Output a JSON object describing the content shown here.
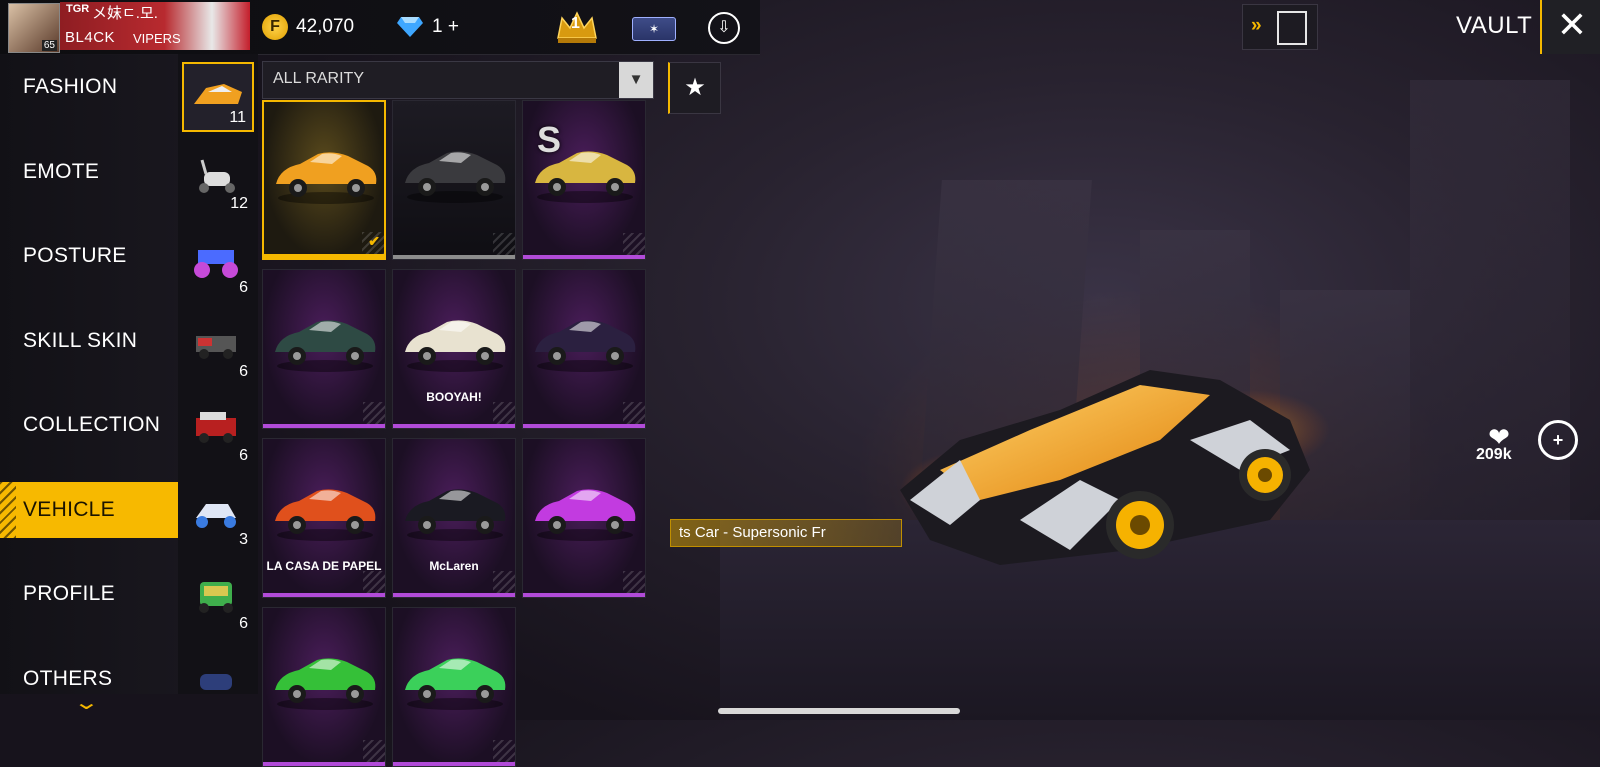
{
  "player": {
    "level": "65",
    "clan_tag": "TGR",
    "clan_name": "メ妺ㄷ.모.",
    "name": "BL4CK",
    "name_suffix": "VIPERS"
  },
  "currency": {
    "gold_symbol": "F",
    "gold": "42,070",
    "diamonds": "1",
    "diamonds_add": "+"
  },
  "top_icons": {
    "rank": "1",
    "card_label": "✶",
    "cloud": "⇩"
  },
  "header": {
    "forward": "»",
    "title": "VAULT",
    "close": "✕"
  },
  "sidebar": {
    "items": [
      {
        "label": "FASHION"
      },
      {
        "label": "EMOTE"
      },
      {
        "label": "POSTURE"
      },
      {
        "label": "SKILL SKIN"
      },
      {
        "label": "COLLECTION"
      },
      {
        "label": "VEHICLE",
        "active": true
      },
      {
        "label": "PROFILE"
      },
      {
        "label": "OTHERS"
      }
    ],
    "more_arrow": "⌄"
  },
  "categories": [
    {
      "icon": "sports-car-icon",
      "count": "11",
      "active": true
    },
    {
      "icon": "scooter-icon",
      "count": "12"
    },
    {
      "icon": "monster-truck-icon",
      "count": "6"
    },
    {
      "icon": "jeep-icon",
      "count": "6"
    },
    {
      "icon": "jeep-red-icon",
      "count": "6"
    },
    {
      "icon": "buggy-icon",
      "count": "3"
    },
    {
      "icon": "tuk-tuk-icon",
      "count": "6"
    }
  ],
  "filter": {
    "label": "ALL RARITY",
    "dropdown": "▼"
  },
  "favorites": {
    "icon": "★"
  },
  "tiles": [
    {
      "rarity": "gold",
      "color": "#f0a020",
      "selected": true,
      "badge": ""
    },
    {
      "rarity": "grey",
      "color": "#3a3a3e",
      "selected": false,
      "badge": ""
    },
    {
      "rarity": "purple",
      "color": "#d8b640",
      "selected": false,
      "badge": "S"
    },
    {
      "rarity": "purple",
      "color": "#2e4a44",
      "selected": false,
      "badge": ""
    },
    {
      "rarity": "purple",
      "color": "#e8e2d0",
      "selected": false,
      "badge": "",
      "brand": "BOOYAH!"
    },
    {
      "rarity": "purple",
      "color": "#2b2040",
      "selected": false,
      "badge": ""
    },
    {
      "rarity": "purple",
      "color": "#e0501c",
      "selected": false,
      "badge": "",
      "brand": "LA CASA DE PAPEL"
    },
    {
      "rarity": "purple",
      "color": "#1a1a22",
      "selected": false,
      "badge": "",
      "brand": "McLaren"
    },
    {
      "rarity": "purple",
      "color": "#c23be0",
      "selected": false,
      "badge": ""
    },
    {
      "rarity": "purple",
      "color": "#35c038",
      "selected": false,
      "badge": ""
    },
    {
      "rarity": "purple",
      "color": "#3bd05a",
      "selected": false,
      "badge": ""
    }
  ],
  "item_name": "ts Car - Supersonic Fr",
  "likes": {
    "count": "209k",
    "icon": "❤"
  },
  "zoom": {
    "icon": "+"
  },
  "colors": {
    "accent": "#f5b800",
    "purple_rarity": "#b14bd8"
  }
}
